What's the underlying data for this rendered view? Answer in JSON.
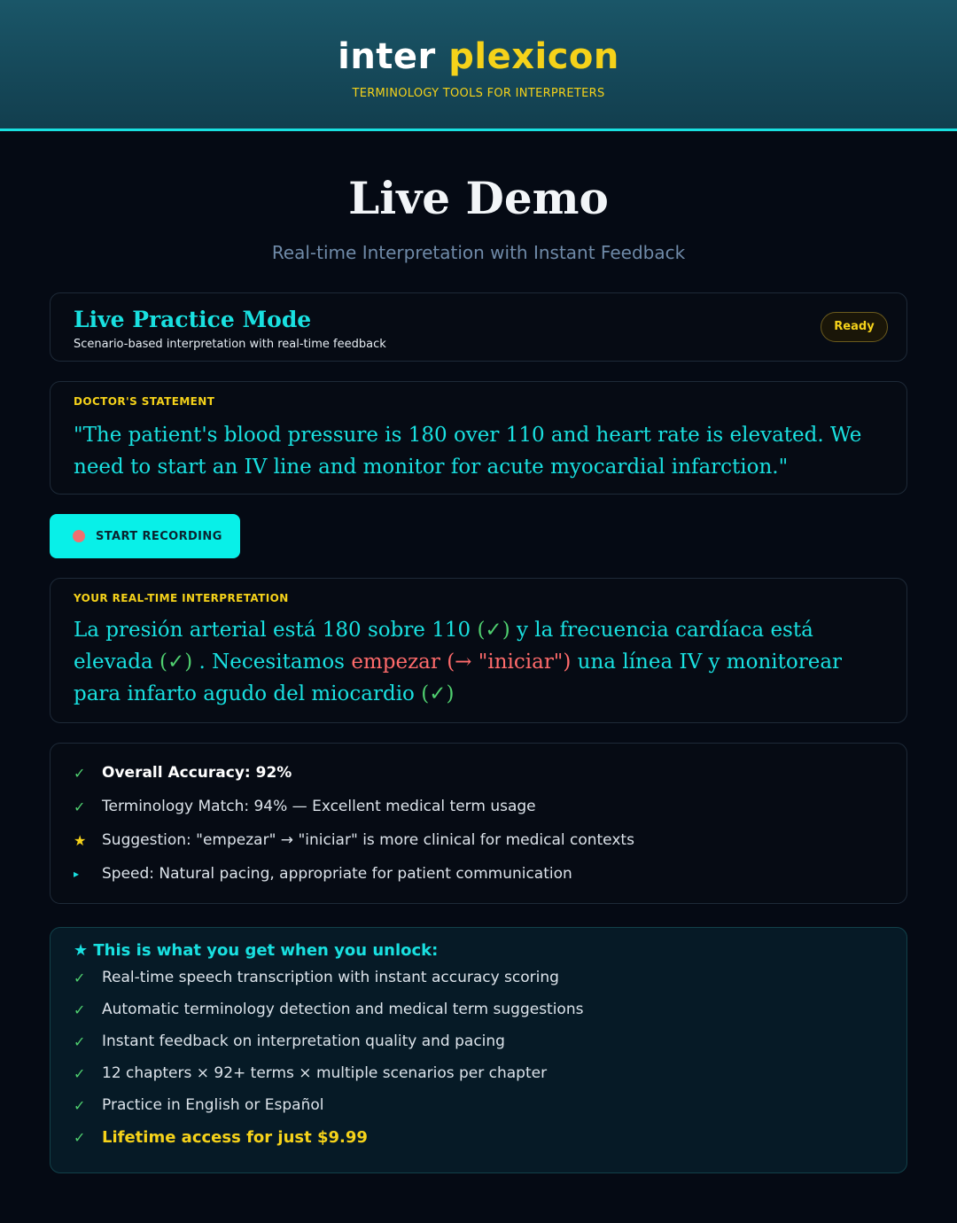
{
  "header": {
    "brand_part1": "inter",
    "brand_part2": "plexicon",
    "tagline": "TERMINOLOGY TOOLS FOR INTERPRETERS"
  },
  "page": {
    "title": "Live Demo",
    "subtitle": "Real-time Interpretation with Instant Feedback"
  },
  "mode": {
    "title": "Live Practice Mode",
    "description": "Scenario-based interpretation with real-time feedback",
    "status": "Ready"
  },
  "statement": {
    "label": "DOCTOR'S STATEMENT",
    "text": "\"The patient's blood pressure is 180 over 110 and heart rate is elevated. We need to start an IV line and monitor for acute myocardial infarction.\""
  },
  "record_button": {
    "label": "START RECORDING"
  },
  "interpretation": {
    "label": "YOUR REAL-TIME INTERPRETATION",
    "segments": {
      "s1": "La presión arterial está 180 sobre 110 ",
      "c1": "(✓)",
      "s2": " y la frecuencia cardíaca está elevada ",
      "c2": "(✓)",
      "s3": " . Necesitamos ",
      "e1": "empezar (→ \"iniciar\")",
      "s4": " una línea IV y monitorear para infarto agudo del miocardio ",
      "c3": "(✓)"
    }
  },
  "feedback": {
    "items": [
      {
        "mark": "✓",
        "text": "Overall Accuracy: 92%"
      },
      {
        "mark": "✓",
        "text": "Terminology Match: 94% — Excellent medical term usage"
      },
      {
        "mark": "★",
        "text": "Suggestion: \"empezar\" → \"iniciar\" is more clinical for medical contexts"
      },
      {
        "mark": "▸",
        "text": "Speed: Natural pacing, appropriate for patient communication"
      }
    ]
  },
  "unlock": {
    "title": "★ This is what you get when you unlock:",
    "items": [
      "Real-time speech transcription with instant accuracy scoring",
      "Automatic terminology detection and medical term suggestions",
      "Instant feedback on interpretation quality and pacing",
      "12 chapters × 92+ terms × multiple scenarios per chapter",
      "Practice in English or Español",
      "Lifetime access for just $9.99"
    ],
    "check": "✓"
  },
  "colors": {
    "accent": "#19e0e0",
    "brand_yellow": "#f5d21a",
    "success": "#4fcf6f",
    "error": "#ff6b6b",
    "background": "#050a14"
  }
}
